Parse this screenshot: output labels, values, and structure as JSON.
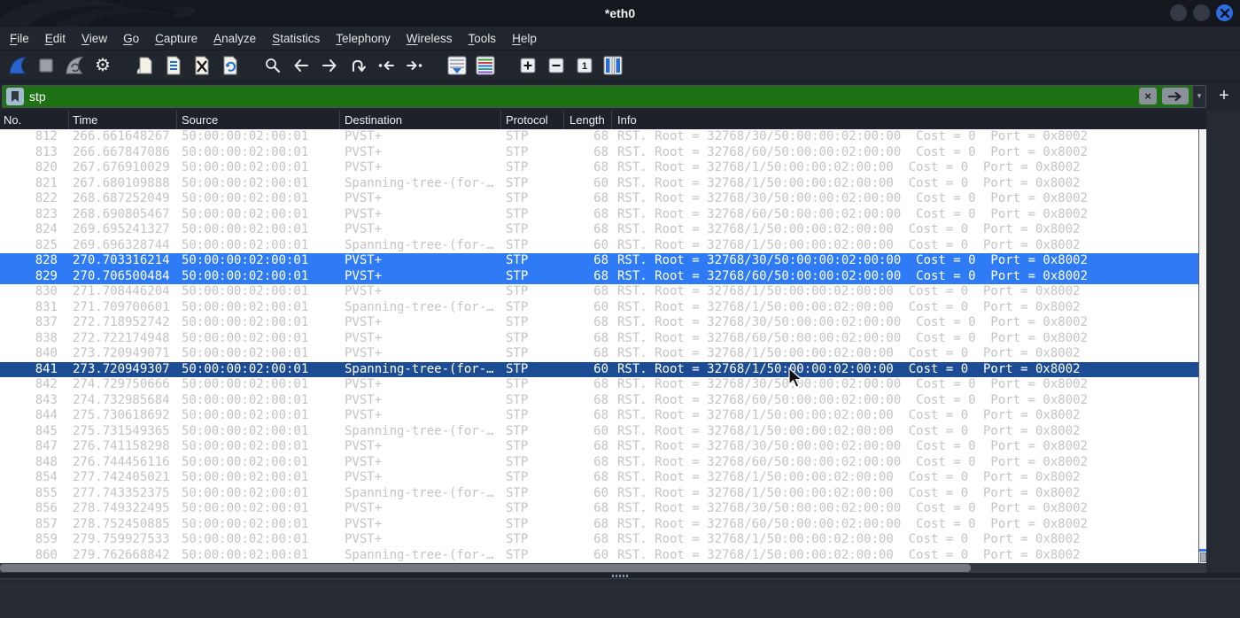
{
  "window": {
    "title": "*eth0",
    "controls": [
      "minimize",
      "maximize",
      "close"
    ]
  },
  "menu": {
    "items": [
      "File",
      "Edit",
      "View",
      "Go",
      "Capture",
      "Analyze",
      "Statistics",
      "Telephony",
      "Wireless",
      "Tools",
      "Help"
    ]
  },
  "toolbar": {
    "buttons": [
      "start-capture",
      "stop-capture",
      "restart-capture",
      "capture-options",
      "open-file",
      "save-file",
      "close-file",
      "reload-file",
      "find-packet",
      "go-back",
      "go-forward",
      "go-to-packet",
      "go-to-first-packet",
      "go-to-last-packet",
      "auto-scroll",
      "colorize",
      "zoom-in",
      "zoom-out",
      "zoom-100",
      "resize-columns"
    ]
  },
  "filter": {
    "value": "stp",
    "clear_glyph": "×",
    "caret_glyph": "▾",
    "add_glyph": "+"
  },
  "colors": {
    "titlebar": "#14181e",
    "chrome": "#21252d",
    "panel": "#262a33",
    "filter_valid_green": "#1d7113",
    "selection_active": "#2e7bf5",
    "selection_inactive": "#1b4c94",
    "row_text": "#c4c4c4",
    "close_button": "#2d6ce0"
  },
  "packet_list": {
    "columns": [
      {
        "key": "no",
        "label": "No."
      },
      {
        "key": "time",
        "label": "Time"
      },
      {
        "key": "source",
        "label": "Source"
      },
      {
        "key": "destination",
        "label": "Destination"
      },
      {
        "key": "protocol",
        "label": "Protocol"
      },
      {
        "key": "length",
        "label": "Length"
      },
      {
        "key": "info",
        "label": "Info"
      }
    ],
    "rows": [
      {
        "no": "812",
        "time": "266.661648267",
        "src": "50:00:00:02:00:01",
        "dst": "PVST+",
        "proto": "STP",
        "len": "68",
        "info": "RST. Root = 32768/30/50:00:00:02:00:00  Cost = 0  Port = 0x8002",
        "state": ""
      },
      {
        "no": "813",
        "time": "266.667847086",
        "src": "50:00:00:02:00:01",
        "dst": "PVST+",
        "proto": "STP",
        "len": "68",
        "info": "RST. Root = 32768/60/50:00:00:02:00:00  Cost = 0  Port = 0x8002",
        "state": ""
      },
      {
        "no": "820",
        "time": "267.676910029",
        "src": "50:00:00:02:00:01",
        "dst": "PVST+",
        "proto": "STP",
        "len": "68",
        "info": "RST. Root = 32768/1/50:00:00:02:00:00  Cost = 0  Port = 0x8002",
        "state": ""
      },
      {
        "no": "821",
        "time": "267.680109888",
        "src": "50:00:00:02:00:01",
        "dst": "Spanning-tree-(for-…",
        "proto": "STP",
        "len": "60",
        "info": "RST. Root = 32768/1/50:00:00:02:00:00  Cost = 0  Port = 0x8002",
        "state": ""
      },
      {
        "no": "822",
        "time": "268.687252049",
        "src": "50:00:00:02:00:01",
        "dst": "PVST+",
        "proto": "STP",
        "len": "68",
        "info": "RST. Root = 32768/30/50:00:00:02:00:00  Cost = 0  Port = 0x8002",
        "state": ""
      },
      {
        "no": "823",
        "time": "268.690805467",
        "src": "50:00:00:02:00:01",
        "dst": "PVST+",
        "proto": "STP",
        "len": "68",
        "info": "RST. Root = 32768/60/50:00:00:02:00:00  Cost = 0  Port = 0x8002",
        "state": ""
      },
      {
        "no": "824",
        "time": "269.695241327",
        "src": "50:00:00:02:00:01",
        "dst": "PVST+",
        "proto": "STP",
        "len": "68",
        "info": "RST. Root = 32768/1/50:00:00:02:00:00  Cost = 0  Port = 0x8002",
        "state": ""
      },
      {
        "no": "825",
        "time": "269.696328744",
        "src": "50:00:00:02:00:01",
        "dst": "Spanning-tree-(for-…",
        "proto": "STP",
        "len": "60",
        "info": "RST. Root = 32768/1/50:00:00:02:00:00  Cost = 0  Port = 0x8002",
        "state": ""
      },
      {
        "no": "828",
        "time": "270.703316214",
        "src": "50:00:00:02:00:01",
        "dst": "PVST+",
        "proto": "STP",
        "len": "68",
        "info": "RST. Root = 32768/30/50:00:00:02:00:00  Cost = 0  Port = 0x8002",
        "state": "selected"
      },
      {
        "no": "829",
        "time": "270.706500484",
        "src": "50:00:00:02:00:01",
        "dst": "PVST+",
        "proto": "STP",
        "len": "68",
        "info": "RST. Root = 32768/60/50:00:00:02:00:00  Cost = 0  Port = 0x8002",
        "state": "selected"
      },
      {
        "no": "830",
        "time": "271.708446204",
        "src": "50:00:00:02:00:01",
        "dst": "PVST+",
        "proto": "STP",
        "len": "68",
        "info": "RST. Root = 32768/1/50:00:00:02:00:00  Cost = 0  Port = 0x8002",
        "state": ""
      },
      {
        "no": "831",
        "time": "271.709700601",
        "src": "50:00:00:02:00:01",
        "dst": "Spanning-tree-(for-…",
        "proto": "STP",
        "len": "60",
        "info": "RST. Root = 32768/1/50:00:00:02:00:00  Cost = 0  Port = 0x8002",
        "state": ""
      },
      {
        "no": "837",
        "time": "272.718952742",
        "src": "50:00:00:02:00:01",
        "dst": "PVST+",
        "proto": "STP",
        "len": "68",
        "info": "RST. Root = 32768/30/50:00:00:02:00:00  Cost = 0  Port = 0x8002",
        "state": ""
      },
      {
        "no": "838",
        "time": "272.722174948",
        "src": "50:00:00:02:00:01",
        "dst": "PVST+",
        "proto": "STP",
        "len": "68",
        "info": "RST. Root = 32768/60/50:00:00:02:00:00  Cost = 0  Port = 0x8002",
        "state": ""
      },
      {
        "no": "840",
        "time": "273.720949071",
        "src": "50:00:00:02:00:01",
        "dst": "PVST+",
        "proto": "STP",
        "len": "68",
        "info": "RST. Root = 32768/1/50:00:00:02:00:00  Cost = 0  Port = 0x8002",
        "state": ""
      },
      {
        "no": "841",
        "time": "273.720949307",
        "src": "50:00:00:02:00:01",
        "dst": "Spanning-tree-(for-…",
        "proto": "STP",
        "len": "60",
        "info": "RST. Root = 32768/1/50:00:00:02:00:00  Cost = 0  Port = 0x8002",
        "state": "focused"
      },
      {
        "no": "842",
        "time": "274.729750666",
        "src": "50:00:00:02:00:01",
        "dst": "PVST+",
        "proto": "STP",
        "len": "68",
        "info": "RST. Root = 32768/30/50:00:00:02:00:00  Cost = 0  Port = 0x8002",
        "state": ""
      },
      {
        "no": "843",
        "time": "274.732985684",
        "src": "50:00:00:02:00:01",
        "dst": "PVST+",
        "proto": "STP",
        "len": "68",
        "info": "RST. Root = 32768/60/50:00:00:02:00:00  Cost = 0  Port = 0x8002",
        "state": ""
      },
      {
        "no": "844",
        "time": "275.730618692",
        "src": "50:00:00:02:00:01",
        "dst": "PVST+",
        "proto": "STP",
        "len": "68",
        "info": "RST. Root = 32768/1/50:00:00:02:00:00  Cost = 0  Port = 0x8002",
        "state": ""
      },
      {
        "no": "845",
        "time": "275.731549365",
        "src": "50:00:00:02:00:01",
        "dst": "Spanning-tree-(for-…",
        "proto": "STP",
        "len": "60",
        "info": "RST. Root = 32768/1/50:00:00:02:00:00  Cost = 0  Port = 0x8002",
        "state": ""
      },
      {
        "no": "847",
        "time": "276.741158298",
        "src": "50:00:00:02:00:01",
        "dst": "PVST+",
        "proto": "STP",
        "len": "68",
        "info": "RST. Root = 32768/30/50:00:00:02:00:00  Cost = 0  Port = 0x8002",
        "state": ""
      },
      {
        "no": "848",
        "time": "276.744456116",
        "src": "50:00:00:02:00:01",
        "dst": "PVST+",
        "proto": "STP",
        "len": "68",
        "info": "RST. Root = 32768/60/50:00:00:02:00:00  Cost = 0  Port = 0x8002",
        "state": ""
      },
      {
        "no": "854",
        "time": "277.742405021",
        "src": "50:00:00:02:00:01",
        "dst": "PVST+",
        "proto": "STP",
        "len": "68",
        "info": "RST. Root = 32768/1/50:00:00:02:00:00  Cost = 0  Port = 0x8002",
        "state": ""
      },
      {
        "no": "855",
        "time": "277.743352375",
        "src": "50:00:00:02:00:01",
        "dst": "Spanning-tree-(for-…",
        "proto": "STP",
        "len": "60",
        "info": "RST. Root = 32768/1/50:00:00:02:00:00  Cost = 0  Port = 0x8002",
        "state": ""
      },
      {
        "no": "856",
        "time": "278.749322495",
        "src": "50:00:00:02:00:01",
        "dst": "PVST+",
        "proto": "STP",
        "len": "68",
        "info": "RST. Root = 32768/30/50:00:00:02:00:00  Cost = 0  Port = 0x8002",
        "state": ""
      },
      {
        "no": "857",
        "time": "278.752450885",
        "src": "50:00:00:02:00:01",
        "dst": "PVST+",
        "proto": "STP",
        "len": "68",
        "info": "RST. Root = 32768/60/50:00:00:02:00:00  Cost = 0  Port = 0x8002",
        "state": ""
      },
      {
        "no": "859",
        "time": "279.759927533",
        "src": "50:00:00:02:00:01",
        "dst": "PVST+",
        "proto": "STP",
        "len": "68",
        "info": "RST. Root = 32768/1/50:00:00:02:00:00  Cost = 0  Port = 0x8002",
        "state": ""
      },
      {
        "no": "860",
        "time": "279.762668842",
        "src": "50:00:00:02:00:01",
        "dst": "Spanning-tree-(for-…",
        "proto": "STP",
        "len": "60",
        "info": "RST. Root = 32768/1/50:00:00:02:00:00  Cost = 0  Port = 0x8002",
        "state": ""
      }
    ]
  }
}
